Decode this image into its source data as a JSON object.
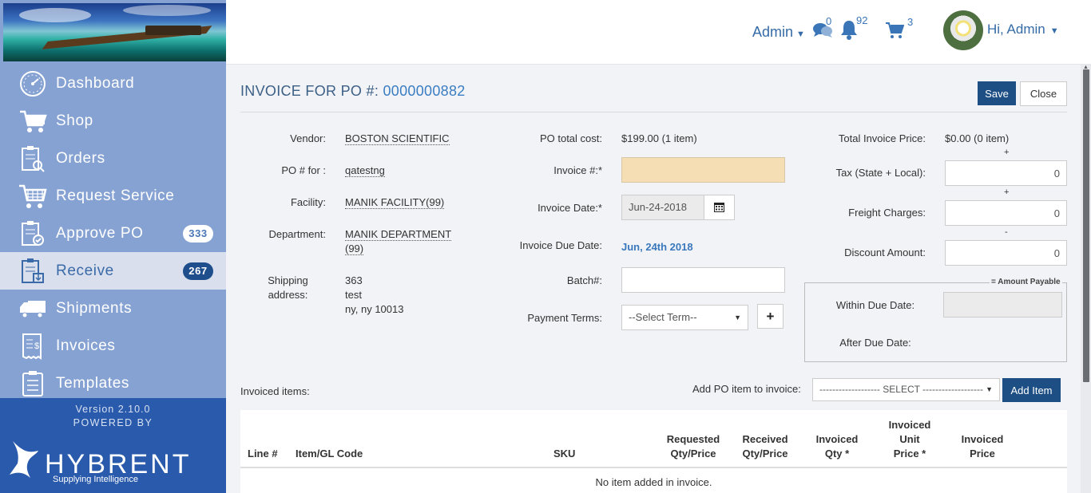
{
  "sidebar": {
    "items": [
      {
        "label": "Dashboard",
        "icon": "dashboard-icon",
        "badge": null
      },
      {
        "label": "Shop",
        "icon": "cart-icon",
        "badge": null
      },
      {
        "label": "Orders",
        "icon": "orders-icon",
        "badge": null
      },
      {
        "label": "Request Service",
        "icon": "request-service-icon",
        "badge": null
      },
      {
        "label": "Approve PO",
        "icon": "approve-po-icon",
        "badge": "333"
      },
      {
        "label": "Receive",
        "icon": "receive-icon",
        "badge": "267"
      },
      {
        "label": "Shipments",
        "icon": "truck-icon",
        "badge": null
      },
      {
        "label": "Invoices",
        "icon": "invoice-icon",
        "badge": null
      },
      {
        "label": "Templates",
        "icon": "templates-icon",
        "badge": null
      }
    ],
    "version": "Version 2.10.0",
    "powered_by": "POWERED BY",
    "brand_name": "HYBRENT",
    "brand_tagline": "Supplying Intelligence"
  },
  "topbar": {
    "admin_menu": "Admin",
    "messages_count": "0",
    "notifications_count": "92",
    "cart_count": "3",
    "greeting": "Hi, Admin"
  },
  "page": {
    "title_prefix": "INVOICE FOR PO #:",
    "po_number": "0000000882",
    "save_label": "Save",
    "close_label": "Close"
  },
  "po_info": {
    "vendor_label": "Vendor:",
    "vendor": "BOSTON SCIENTIFIC",
    "po_for_label": "PO # for :",
    "po_for": "qatestng",
    "facility_label": "Facility:",
    "facility": "MANIK FACILITY(99)",
    "department_label": "Department:",
    "department_line1": "MANIK DEPARTMENT",
    "department_line2": "(99)",
    "shipping_label_1": "Shipping",
    "shipping_label_2": "address:",
    "shipping_line1": "363",
    "shipping_line2": "test",
    "shipping_line3": "ny, ny 10013"
  },
  "invoice_form": {
    "po_total_label": "PO total cost:",
    "po_total": "$199.00 (1 item)",
    "invoice_no_label": "Invoice #:*",
    "invoice_no": "",
    "invoice_date_label": "Invoice Date:*",
    "invoice_date": "Jun-24-2018",
    "due_date_label": "Invoice Due Date:",
    "due_date": "Jun, 24th 2018",
    "batch_label": "Batch#:",
    "batch": "",
    "payment_terms_label": "Payment Terms:",
    "payment_terms": "--Select Term--",
    "add_term": "+"
  },
  "totals": {
    "total_invoice_label": "Total Invoice Price:",
    "total_invoice": "$0.00 (0 item)",
    "plus1": "+",
    "tax_label": "Tax (State + Local):",
    "tax": "0",
    "plus2": "+",
    "freight_label": "Freight Charges:",
    "freight": "0",
    "minus": "-",
    "discount_label": "Discount Amount:",
    "discount": "0",
    "amount_payable_title": "= Amount Payable",
    "within_due_label": "Within Due Date:",
    "within_due": "",
    "after_due_label": "After Due Date:"
  },
  "items": {
    "invoiced_items_label": "Invoiced items:",
    "add_po_item_label": "Add PO item to invoice:",
    "add_select": "------------------- SELECT -------------------",
    "add_item_button": "Add Item",
    "columns": {
      "line": "Line #",
      "item_gl": "Item/GL Code",
      "sku": "SKU",
      "requested_1": "Requested",
      "requested_2": "Qty/Price",
      "received_1": "Received",
      "received_2": "Qty/Price",
      "inv_qty_1": "Invoiced",
      "inv_qty_2": "Qty *",
      "inv_unit_1": "Invoiced",
      "inv_unit_2": "Unit",
      "inv_unit_3": "Price *",
      "inv_price_1": "Invoiced",
      "inv_price_2": "Price"
    },
    "empty_message": "No item added in invoice."
  }
}
